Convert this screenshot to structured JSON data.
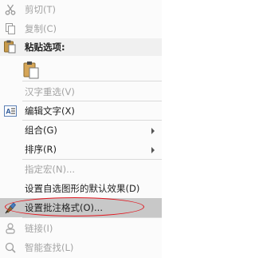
{
  "menu": {
    "items": {
      "cut": {
        "label": "剪切(T)",
        "icon": "scissors-icon",
        "enabled": false
      },
      "copy": {
        "label": "复制(C)",
        "icon": "copy-icon",
        "enabled": false
      },
      "paste_header": {
        "label": "粘贴选项:",
        "icon": "paste-icon"
      },
      "paste_option": {
        "icon": "paste-keep-format-icon"
      },
      "reconvert": {
        "label": "汉字重选(V)",
        "enabled": false
      },
      "edit_text": {
        "label": "编辑文字(X)",
        "icon": "edit-text-icon",
        "enabled": true
      },
      "group": {
        "label": "组合(G)",
        "has_submenu": true,
        "enabled": true
      },
      "order": {
        "label": "排序(R)",
        "has_submenu": true,
        "enabled": true
      },
      "assign_macro": {
        "label": "指定宏(N)...",
        "enabled": false
      },
      "set_default": {
        "label": "设置自选图形的默认效果(D)",
        "enabled": true
      },
      "format_comment": {
        "label": "设置批注格式(O)...",
        "icon": "format-brush-icon",
        "enabled": true,
        "highlighted": true
      },
      "link": {
        "label": "链接(I)",
        "icon": "link-icon",
        "enabled": false
      },
      "smart_lookup": {
        "label": "智能查找(L)",
        "icon": "smart-lookup-icon",
        "enabled": false
      }
    }
  },
  "colors": {
    "highlight": "#c8c8c8",
    "annotation_ellipse": "#e2141d",
    "disabled_text": "#a3a3a3"
  }
}
